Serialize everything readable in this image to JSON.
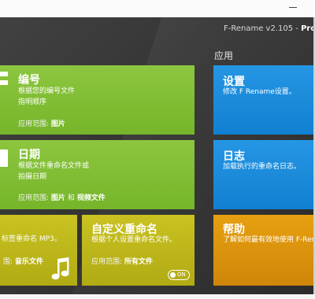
{
  "window": {
    "title_prefix": "F-Rename v2.105 - ",
    "title_edition": "Professio"
  },
  "sections": {
    "apps_title": "应用"
  },
  "tiles": {
    "numbering": {
      "title": "编号",
      "desc1": "根据您的编号文件",
      "desc2": "指明顺序",
      "scope_label": "应用范围:",
      "scope_value": "图片"
    },
    "date": {
      "title": "日期",
      "desc1": "根据文件重命名文件或",
      "desc2": "拍摄日期",
      "scope_label": "应用范围:",
      "scope_value1": "图片",
      "scope_and": "和",
      "scope_value2": "视频文件"
    },
    "music": {
      "desc": "标签重命名 MP3。",
      "scope_label": "围:",
      "scope_value": "音乐文件"
    },
    "custom": {
      "title": "自定义重命名",
      "desc": "根据个人设置重命名文件。",
      "scope_label": "应用范围:",
      "scope_value": "所有文件",
      "toggle_text": "ON"
    },
    "settings": {
      "title": "设置",
      "desc": "修改 F Rename设置。"
    },
    "log": {
      "title": "日志",
      "desc": "加载执行的重命名日志。"
    },
    "help": {
      "title": "帮助",
      "desc": "了解如何最有效地使用 F-Rena"
    }
  },
  "colors": {
    "green": "#80bd34",
    "yellow": "#bdb71b",
    "blue": "#1a8ada",
    "orange": "#dc930d",
    "window_bg": "#353535"
  },
  "icons": {
    "numbering": "number-icon",
    "date": "calendar-icon",
    "music": "music-note-icon",
    "toggle": "toggle-switch"
  }
}
